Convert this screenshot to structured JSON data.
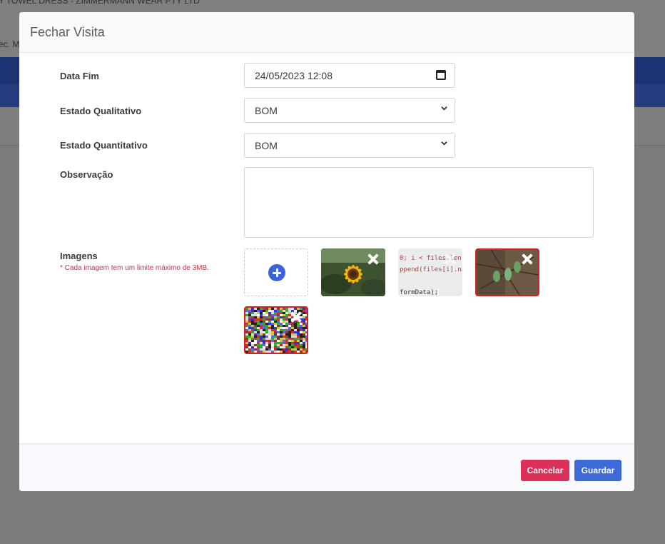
{
  "background": {
    "header_text": "Y TOWEL DRESS - ZIMMERMANN WEAR PTY LTD",
    "sub_text": "ec. M"
  },
  "modal": {
    "title": "Fechar Visita",
    "fields": {
      "data_fim": {
        "label": "Data Fim",
        "value": "24/05/2023 12:08"
      },
      "estado_qualitativo": {
        "label": "Estado Qualitativo",
        "value": "BOM"
      },
      "estado_quantitativo": {
        "label": "Estado Quantitativo",
        "value": "BOM"
      },
      "observacao": {
        "label": "Observação",
        "value": ""
      },
      "imagens": {
        "label": "Imagens",
        "hint": "* Cada imagem tem um limite máximo de 3MB.",
        "thumbnails": [
          {
            "name": "sunflower",
            "invalid": false
          },
          {
            "name": "code-screenshot",
            "invalid": false,
            "code_lines": [
              "0; i < files.len",
              "ppend(files[i].na",
              "",
              "formData);"
            ]
          },
          {
            "name": "parrots",
            "invalid": true
          },
          {
            "name": "noise-image",
            "invalid": true
          }
        ]
      }
    },
    "buttons": {
      "cancel": "Cancelar",
      "save": "Guardar"
    }
  },
  "colors": {
    "primary": "#3d6ad6",
    "danger": "#dc2f5a",
    "invalid_border": "#d42020"
  }
}
